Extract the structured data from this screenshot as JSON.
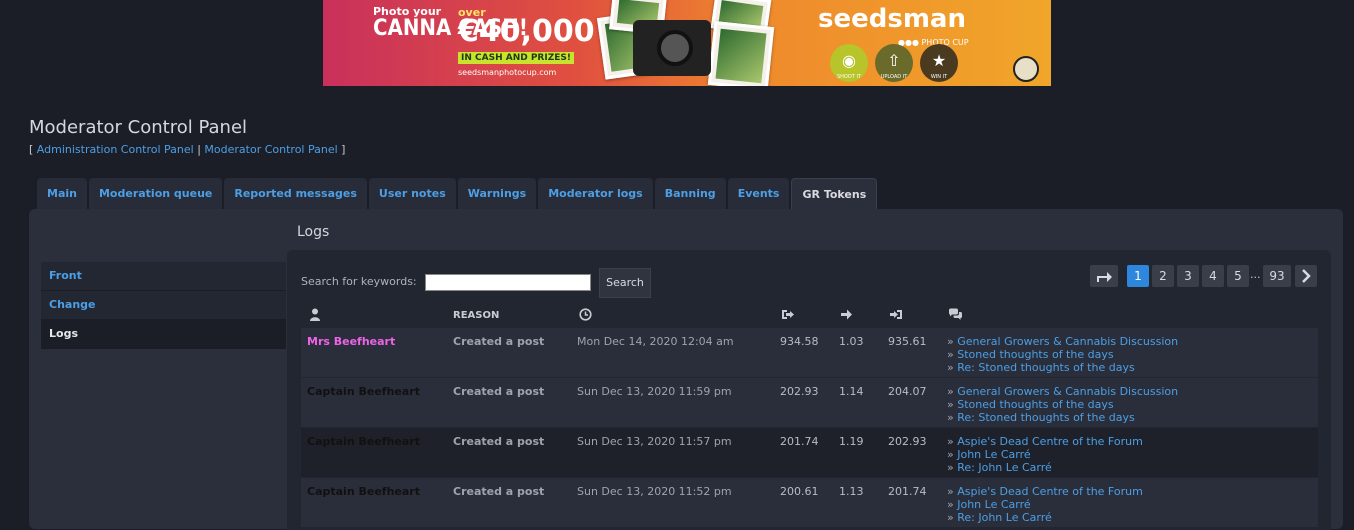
{
  "banner": {
    "line1": "Photo your",
    "line2": "CANNA CASH!",
    "over": "over",
    "amount": "€40,000",
    "prize": "IN CASH AND PRIZES!",
    "url": "seedsmanphotocup.com",
    "brand": "seedsman",
    "brand_sub": "●●● PHOTO CUP",
    "steps": [
      "SHOOT IT",
      "UPLOAD IT",
      "WIN IT"
    ]
  },
  "header": {
    "title": "Moderator Control Panel",
    "links": [
      "Administration Control Panel",
      "Moderator Control Panel"
    ]
  },
  "tabs": [
    {
      "label": "Main"
    },
    {
      "label": "Moderation queue"
    },
    {
      "label": "Reported messages"
    },
    {
      "label": "User notes"
    },
    {
      "label": "Warnings"
    },
    {
      "label": "Moderator logs"
    },
    {
      "label": "Banning"
    },
    {
      "label": "Events"
    },
    {
      "label": "GR Tokens"
    }
  ],
  "sidebar": {
    "items": [
      {
        "label": "Front"
      },
      {
        "label": "Change"
      },
      {
        "label": "Logs"
      }
    ]
  },
  "main": {
    "title": "Logs",
    "search_label": "Search for keywords:",
    "search_value": "",
    "search_button": "Search"
  },
  "pagination": {
    "pages": [
      "1",
      "2",
      "3",
      "4",
      "5",
      "93"
    ],
    "ellipsis": "..."
  },
  "table": {
    "reason_header": "REASON",
    "rows": [
      {
        "user": "Mrs Beefheart",
        "reason": "Created a post",
        "date": "Mon Dec 14, 2020 12:04 am",
        "before": "934.58",
        "change": "1.03",
        "after": "935.61",
        "links": [
          "General Growers & Cannabis Discussion",
          "Stoned thoughts of the days",
          "Re: Stoned thoughts of the days"
        ]
      },
      {
        "user": "Captain Beefheart",
        "reason": "Created a post",
        "date": "Sun Dec 13, 2020 11:59 pm",
        "before": "202.93",
        "change": "1.14",
        "after": "204.07",
        "links": [
          "General Growers & Cannabis Discussion",
          "Stoned thoughts of the days",
          "Re: Stoned thoughts of the days"
        ]
      },
      {
        "user": "Captain Beefheart",
        "reason": "Created a post",
        "date": "Sun Dec 13, 2020 11:57 pm",
        "before": "201.74",
        "change": "1.19",
        "after": "202.93",
        "links": [
          "Aspie's Dead Centre of the Forum",
          "John Le Carré",
          "Re: John Le Carré"
        ]
      },
      {
        "user": "Captain Beefheart",
        "reason": "Created a post",
        "date": "Sun Dec 13, 2020 11:52 pm",
        "before": "200.61",
        "change": "1.13",
        "after": "201.74",
        "links": [
          "Aspie's Dead Centre of the Forum",
          "John Le Carré",
          "Re: John Le Carré"
        ]
      }
    ]
  },
  "colors": {
    "background": "#1b1e27",
    "link": "#4c9fe6",
    "active_page": "#2d87dc",
    "moderator_user": "#ee63e8"
  }
}
